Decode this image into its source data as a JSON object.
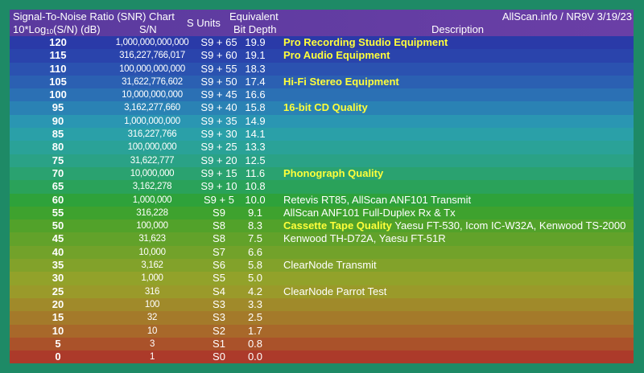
{
  "header": {
    "title": "Signal-To-Noise Ratio (SNR) Chart",
    "db_col_prefix": "10*Log",
    "db_col_sub": "10",
    "db_col_suffix": "(S/N) (dB)",
    "sn_col": "S/N",
    "su_col": "S Units",
    "bd_col_line1": "Equivalent",
    "bd_col_line2": "Bit Depth",
    "desc_col": "Description",
    "credit": "AllScan.info / NR9V 3/19/23"
  },
  "colors": {
    "header_bg": "#5a3a9e",
    "highlight_text": "#ffff3a",
    "text": "#ffffff",
    "border": "#1e8a66"
  },
  "rows": [
    {
      "db": "120",
      "sn": "1,000,000,000,000",
      "su": "S9 + 65",
      "bd": "19.9",
      "hl": "Pro Recording Studio Equipment",
      "desc": "",
      "bg": "#2a3aa8"
    },
    {
      "db": "115",
      "sn": "316,227,766,017",
      "su": "S9 + 60",
      "bd": "19.1",
      "hl": "Pro Audio Equipment",
      "desc": "",
      "bg": "#2a44ac"
    },
    {
      "db": "110",
      "sn": "100,000,000,000",
      "su": "S9 + 55",
      "bd": "18.3",
      "hl": "",
      "desc": "",
      "bg": "#2b52b0"
    },
    {
      "db": "105",
      "sn": "31,622,776,602",
      "su": "S9 + 50",
      "bd": "17.4",
      "hl": "Hi-Fi Stereo Equipment",
      "desc": "",
      "bg": "#2b60b2"
    },
    {
      "db": "100",
      "sn": "10,000,000,000",
      "su": "S9 + 45",
      "bd": "16.6",
      "hl": "",
      "desc": "",
      "bg": "#2b70b4"
    },
    {
      "db": "95",
      "sn": "3,162,277,660",
      "su": "S9 + 40",
      "bd": "15.8",
      "hl": "16-bit CD Quality",
      "desc": "",
      "bg": "#2a82b4"
    },
    {
      "db": "90",
      "sn": "1,000,000,000",
      "su": "S9 + 35",
      "bd": "14.9",
      "hl": "",
      "desc": "",
      "bg": "#2a96b2"
    },
    {
      "db": "85",
      "sn": "316,227,766",
      "su": "S9 + 30",
      "bd": "14.1",
      "hl": "",
      "desc": "",
      "bg": "#2aa0a8"
    },
    {
      "db": "80",
      "sn": "100,000,000",
      "su": "S9 + 25",
      "bd": "13.3",
      "hl": "",
      "desc": "",
      "bg": "#2aa298"
    },
    {
      "db": "75",
      "sn": "31,622,777",
      "su": "S9 + 20",
      "bd": "12.5",
      "hl": "",
      "desc": "",
      "bg": "#2aa286"
    },
    {
      "db": "70",
      "sn": "10,000,000",
      "su": "S9 + 15",
      "bd": "11.6",
      "hl": "Phonograph Quality",
      "desc": "",
      "bg": "#2aa270"
    },
    {
      "db": "65",
      "sn": "3,162,278",
      "su": "S9 + 10",
      "bd": "10.8",
      "hl": "",
      "desc": "",
      "bg": "#2aa25a"
    },
    {
      "db": "60",
      "sn": "1,000,000",
      "su": "S9 + 5",
      "bd": "10.0",
      "hl": "",
      "desc": "Retevis RT85, AllScan ANF101 Transmit",
      "bg": "#2ea23a"
    },
    {
      "db": "55",
      "sn": "316,228",
      "su": "S9",
      "bd": "9.1",
      "hl": "",
      "desc": "AllScan ANF101 Full-Duplex Rx & Tx",
      "bg": "#3ea22e"
    },
    {
      "db": "50",
      "sn": "100,000",
      "su": "S8",
      "bd": "8.3",
      "hl": "Cassette Tape Quality",
      "desc": " Yaesu FT-530, Icom IC-W32A, Kenwood TS-2000",
      "bg": "#52a22a"
    },
    {
      "db": "45",
      "sn": "31,623",
      "su": "S8",
      "bd": "7.5",
      "hl": "",
      "desc": "Kenwood TH-D72A, Yaesu FT-51R",
      "bg": "#62a22a"
    },
    {
      "db": "40",
      "sn": "10,000",
      "su": "S7",
      "bd": "6.6",
      "hl": "",
      "desc": "",
      "bg": "#72a22a"
    },
    {
      "db": "35",
      "sn": "3,162",
      "su": "S6",
      "bd": "5.8",
      "hl": "",
      "desc": "ClearNode Transmit",
      "bg": "#82a22a"
    },
    {
      "db": "30",
      "sn": "1,000",
      "su": "S5",
      "bd": "5.0",
      "hl": "",
      "desc": "",
      "bg": "#92a22a"
    },
    {
      "db": "25",
      "sn": "316",
      "su": "S4",
      "bd": "4.2",
      "hl": "",
      "desc": "ClearNode Parrot Test",
      "bg": "#9a9a2a"
    },
    {
      "db": "20",
      "sn": "100",
      "su": "S3",
      "bd": "3.3",
      "hl": "",
      "desc": "",
      "bg": "#a08a2a"
    },
    {
      "db": "15",
      "sn": "32",
      "su": "S3",
      "bd": "2.5",
      "hl": "",
      "desc": "",
      "bg": "#a47a2a"
    },
    {
      "db": "10",
      "sn": "10",
      "su": "S2",
      "bd": "1.7",
      "hl": "",
      "desc": "",
      "bg": "#a8682a"
    },
    {
      "db": "5",
      "sn": "3",
      "su": "S1",
      "bd": "0.8",
      "hl": "",
      "desc": "",
      "bg": "#aa522a"
    },
    {
      "db": "0",
      "sn": "1",
      "su": "S0",
      "bd": "0.0",
      "hl": "",
      "desc": "",
      "bg": "#ac3a2a"
    }
  ]
}
